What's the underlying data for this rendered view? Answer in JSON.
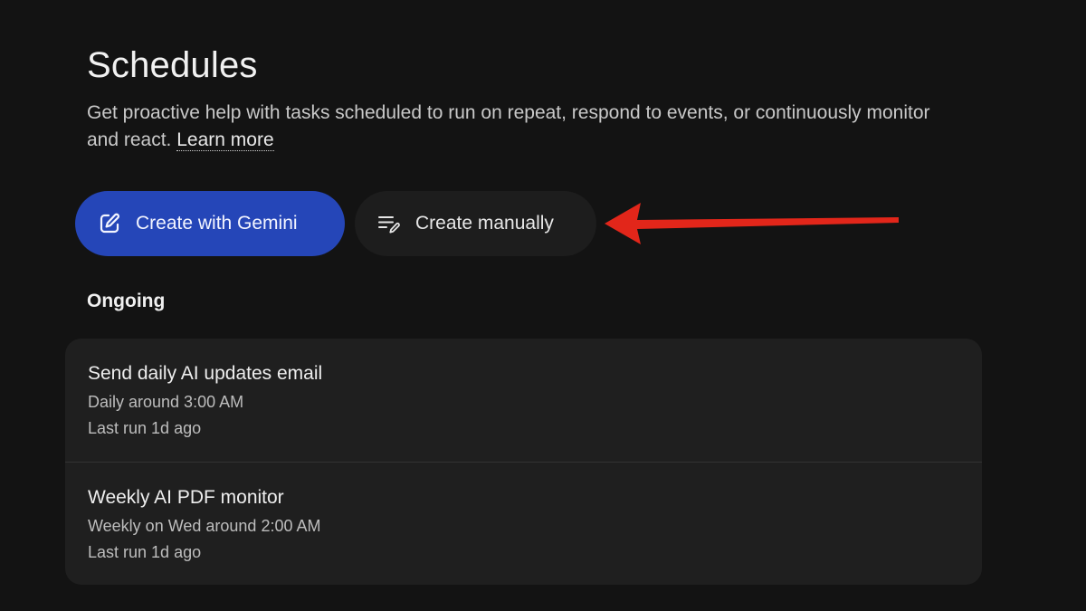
{
  "page": {
    "title": "Schedules",
    "subtitle": "Get proactive help with tasks scheduled to run on repeat, respond to events, or continuously monitor and react.",
    "learn_more": "Learn more"
  },
  "actions": {
    "create_with_gemini": "Create with Gemini",
    "create_manually": "Create manually"
  },
  "sections": {
    "ongoing_label": "Ongoing"
  },
  "schedules": [
    {
      "name": "Send daily AI updates email",
      "frequency": "Daily around 3:00 AM",
      "last_run": "Last run 1d ago"
    },
    {
      "name": "Weekly AI PDF monitor",
      "frequency": "Weekly on Wed around 2:00 AM",
      "last_run": "Last run 1d ago"
    }
  ],
  "icons": {
    "gemini_button": "edit-square-icon",
    "manual_button": "notes-edit-icon"
  },
  "colors": {
    "background": "#131313",
    "primary_button": "#2546b8",
    "secondary_button": "#1d1d1d",
    "card": "#1f1f1f",
    "annotation_arrow": "#e2261a"
  }
}
